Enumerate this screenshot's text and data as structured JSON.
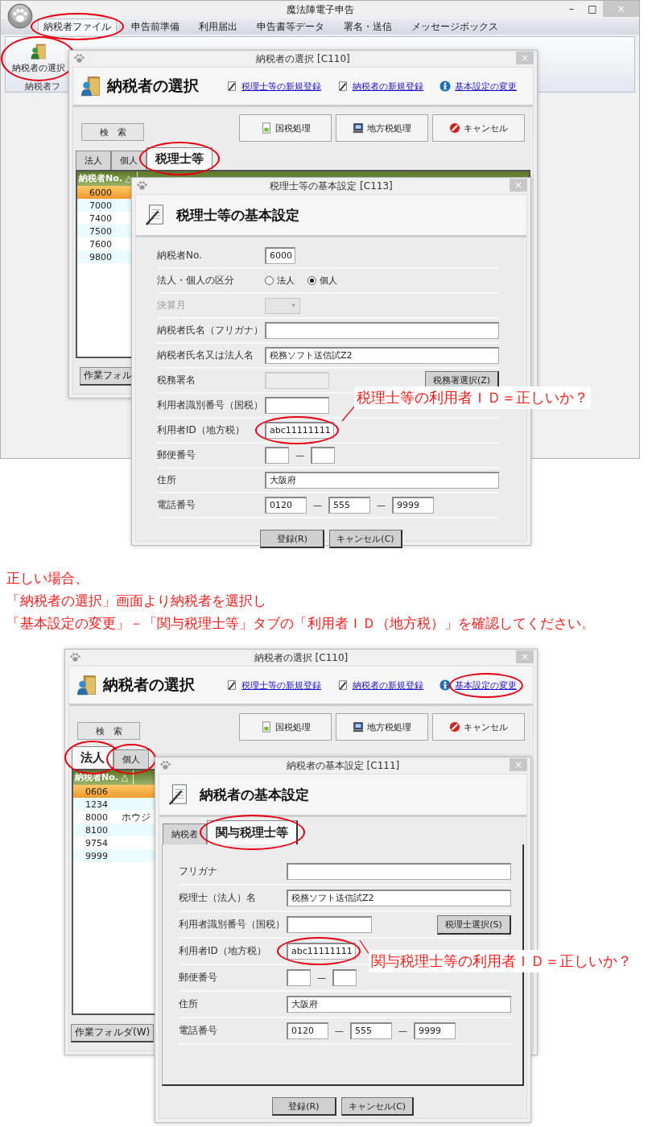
{
  "shot_1": {
    "app_window": {
      "title": "魔法陣電子申告",
      "controls": [
        "–",
        "□",
        "×"
      ],
      "menu": [
        {
          "label": "納税者ファイル",
          "selected": true,
          "circled": true
        },
        {
          "label": "申告前準備",
          "selected": false,
          "circled": false
        },
        {
          "label": "利用届出",
          "selected": false,
          "circled": false
        },
        {
          "label": "申告書等データ",
          "selected": false,
          "circled": false
        },
        {
          "label": "署名・送信",
          "selected": false,
          "circled": false
        },
        {
          "label": "メッセージボックス",
          "selected": false,
          "circled": false
        }
      ],
      "ribbon": {
        "button": {
          "label": "納税者の選択",
          "circled": true
        },
        "group_label": "納税者フ"
      }
    },
    "select_window": {
      "title": "納税者の選択 [C110]",
      "close": "×",
      "heading": "納税者の選択",
      "links": [
        {
          "label": "税理士等の新規登録",
          "circled": false
        },
        {
          "label": "納税者の新規登録",
          "circled": false
        },
        {
          "label": "基本設定の変更",
          "circled": false
        }
      ],
      "search_button": "検　索",
      "action_buttons": [
        "国税処理",
        "地方税処理",
        "キャンセル"
      ],
      "tabs": [
        {
          "label": "法人",
          "selected": false,
          "circled": false
        },
        {
          "label": "個人",
          "selected": false,
          "circled": false
        },
        {
          "label": "税理士等",
          "selected": true,
          "circled": true
        }
      ],
      "table": {
        "columns": [
          "納税者No. △"
        ],
        "rows": [
          {
            "no": "6000",
            "selected": true
          },
          {
            "no": "7000",
            "selected": false
          },
          {
            "no": "7400",
            "selected": false
          },
          {
            "no": "7500",
            "selected": false
          },
          {
            "no": "7600",
            "selected": false
          },
          {
            "no": "9800",
            "selected": false
          }
        ]
      },
      "footer_button": "作業フォル"
    },
    "dialog": {
      "title": "税理士等の基本設定 [C113]",
      "close": "×",
      "heading": "税理士等の基本設定",
      "fields": [
        {
          "kind": "text",
          "label": "納税者No.",
          "value": "6000",
          "circled": false
        },
        {
          "kind": "radio",
          "label": "法人・個人の区分",
          "options": [
            {
              "label": "法人",
              "selected": false
            },
            {
              "label": "個人",
              "selected": true
            }
          ]
        },
        {
          "kind": "select",
          "label": "決算月",
          "disabled": true
        },
        {
          "kind": "text",
          "label": "納税者氏名（フリガナ）",
          "circled": false
        },
        {
          "kind": "text",
          "label": "納税者氏名又は法人名",
          "value": "税務ソフト送信試Z2",
          "circled": false
        },
        {
          "kind": "text_button",
          "label": "税務署名",
          "readonly": true,
          "button": "税務署選択(Z)"
        },
        {
          "kind": "text",
          "label": "利用者識別番号（国税）",
          "circled": false
        },
        {
          "kind": "text",
          "label": "利用者ID（地方税）",
          "value": "abc11111111",
          "circled": true
        },
        {
          "kind": "postal",
          "label": "郵便番号",
          "separator": "—"
        },
        {
          "kind": "text",
          "label": "住所",
          "value": "大阪府",
          "circled": false
        },
        {
          "kind": "phone",
          "label": "電話番号",
          "parts": [
            "0120",
            "555",
            "9999"
          ],
          "separator": "—"
        }
      ],
      "buttons": [
        "登録(R)",
        "キャンセル(C)"
      ]
    },
    "callout": "税理士等の利用者ＩＤ＝正しいか？"
  },
  "instructions": [
    "正しい場合、",
    "「納税者の選択」画面より納税者を選択し",
    "「基本設定の変更」－「関与税理士等」タブの「利用者ＩＤ（地方税）」を確認してください。"
  ],
  "shot_2": {
    "select_window": {
      "title": "納税者の選択 [C110]",
      "close": "×",
      "heading": "納税者の選択",
      "links": [
        {
          "label": "税理士等の新規登録",
          "circled": false
        },
        {
          "label": "納税者の新規登録",
          "circled": false
        },
        {
          "label": "基本設定の変更",
          "circled": true
        }
      ],
      "search_button": "検　索",
      "action_buttons": [
        "国税処理",
        "地方税処理",
        "キャンセル"
      ],
      "tabs": [
        {
          "label": "法人",
          "selected": true,
          "circled": true
        },
        {
          "label": "個人",
          "selected": false,
          "circled": true
        }
      ],
      "table": {
        "columns": [
          "納税者No. △"
        ],
        "rows": [
          {
            "no": "0606",
            "selected": true
          },
          {
            "no": "1234",
            "selected": false
          },
          {
            "no": "8000",
            "kana": "ホウジ",
            "selected": false
          },
          {
            "no": "8100",
            "selected": false
          },
          {
            "no": "9754",
            "selected": false
          },
          {
            "no": "9999",
            "selected": false
          }
        ]
      },
      "footer_button": "作業フォルダ(W)"
    },
    "dialog": {
      "title": "納税者の基本設定 [C111]",
      "close": "×",
      "heading": "納税者の基本設定",
      "tabs": [
        {
          "label": "納税者",
          "selected": false,
          "circled": false
        },
        {
          "label": "関与税理士等",
          "selected": true,
          "circled": true
        }
      ],
      "fields": [
        {
          "kind": "text",
          "label": "フリガナ",
          "circled": false
        },
        {
          "kind": "text",
          "label": "税理士（法人）名",
          "value": "税務ソフト送信試Z2",
          "circled": false
        },
        {
          "kind": "text_button",
          "label": "利用者識別番号（国税）",
          "readonly": false,
          "button": "税理士選択(S)"
        },
        {
          "kind": "text",
          "label": "利用者ID（地方税）",
          "value": "abc11111111",
          "circled": true
        },
        {
          "kind": "postal",
          "label": "郵便番号",
          "separator": "—"
        },
        {
          "kind": "text",
          "label": "住所",
          "value": "大阪府",
          "circled": false
        },
        {
          "kind": "phone",
          "label": "電話番号",
          "parts": [
            "0120",
            "555",
            "9999"
          ],
          "separator": "—"
        }
      ],
      "buttons": [
        "登録(R)",
        "キャンセル(C)"
      ]
    },
    "callout": "関与税理士等の利用者ＩＤ＝正しいか？"
  }
}
